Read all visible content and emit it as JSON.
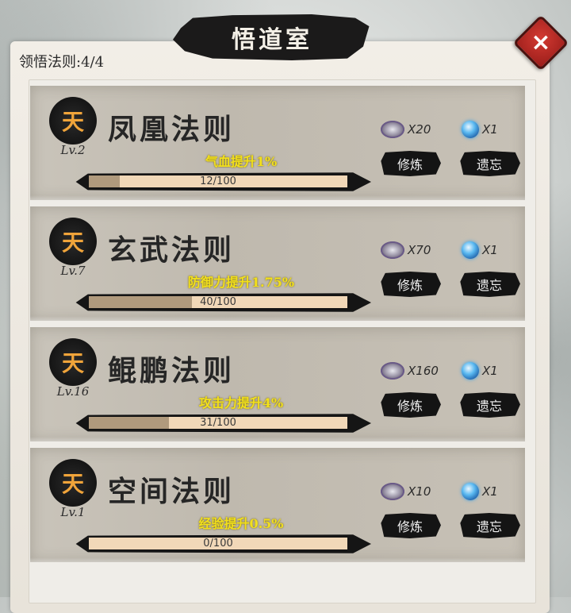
{
  "header": {
    "title": "悟道室",
    "comprehended": "领悟法则:4/4",
    "close_label": "×"
  },
  "laws": [
    {
      "rank": "天",
      "name": "凤凰法则",
      "level": "Lv.2",
      "bonus": "气血提升1%",
      "progress_text": "12/100",
      "progress_fraction": 0.12,
      "scroll_cost": "X20",
      "relic_cost": "X1",
      "cultivate_label": "修炼",
      "forget_label": "遗忘"
    },
    {
      "rank": "天",
      "name": "玄武法则",
      "level": "Lv.7",
      "bonus": "防御力提升1.75%",
      "progress_text": "40/100",
      "progress_fraction": 0.4,
      "scroll_cost": "X70",
      "relic_cost": "X1",
      "cultivate_label": "修炼",
      "forget_label": "遗忘"
    },
    {
      "rank": "天",
      "name": "鲲鹏法则",
      "level": "Lv.16",
      "bonus": "攻击力提升4%",
      "progress_text": "31/100",
      "progress_fraction": 0.31,
      "scroll_cost": "X160",
      "relic_cost": "X1",
      "cultivate_label": "修炼",
      "forget_label": "遗忘"
    },
    {
      "rank": "天",
      "name": "空间法则",
      "level": "Lv.1",
      "bonus": "经验提升0.5%",
      "progress_text": "0/100",
      "progress_fraction": 0.0,
      "scroll_cost": "X10",
      "relic_cost": "X1",
      "cultivate_label": "修炼",
      "forget_label": "遗忘"
    }
  ],
  "icons": {
    "scroll": "scroll-icon",
    "relic": "blue-orb-icon",
    "close": "close-icon"
  },
  "colors": {
    "bonus_text": "#f2e01c",
    "rank_char": "#f0a43a",
    "close_button": "#c0302a"
  }
}
